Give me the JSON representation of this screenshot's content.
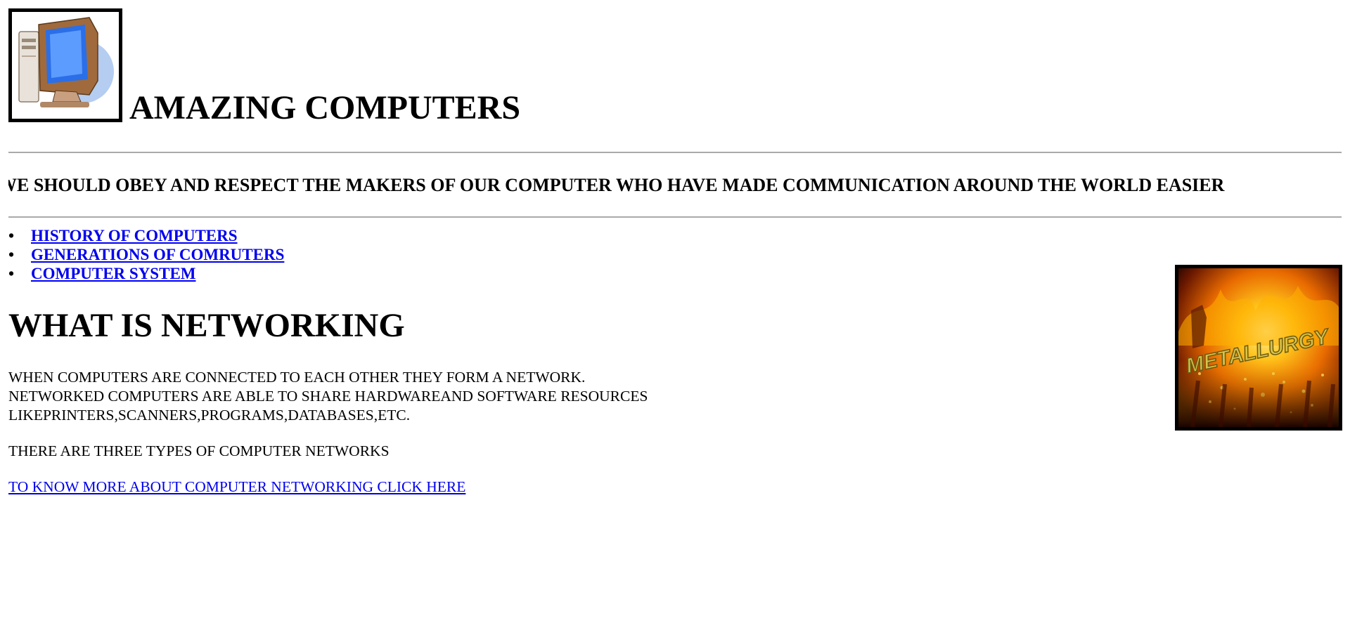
{
  "header": {
    "title": "AMAZING COMPUTERS",
    "logo_icon": "desktop-computer-icon"
  },
  "marquee": {
    "text": "WE SHOULD OBEY AND RESPECT THE MAKERS OF OUR COMPUTER WHO HAVE MADE COMMUNICATION AROUND THE WORLD EASIER"
  },
  "nav": {
    "bullet": "•",
    "items": [
      {
        "label": "HISTORY OF COMPUTERS"
      },
      {
        "label": "GENERATIONS OF COMRUTERS"
      },
      {
        "label": "COMPUTER SYSTEM"
      }
    ]
  },
  "main": {
    "heading": "WHAT IS NETWORKING",
    "paragraph_lines": [
      "WHEN COMPUTERS ARE CONNECTED TO EACH OTHER THEY FORM A NETWORK.",
      "NETWORKED COMPUTERS ARE ABLE TO SHARE HARDWAREAND SOFTWARE RESOURCES",
      "LIKEPRINTERS,SCANNERS,PROGRAMS,DATABASES,ETC."
    ],
    "types_text": "THERE ARE THREE TYPES OF COMPUTER NETWORKS",
    "more_link": "TO KNOW MORE ABOUT COMPUTER NETWORKING CLICK HERE"
  },
  "side_image": {
    "caption": "METALLURGY",
    "icon": "metallurgy-fire-image"
  },
  "colors": {
    "link": "#0000ee",
    "rule": "#aaaaaa",
    "text": "#000000"
  }
}
